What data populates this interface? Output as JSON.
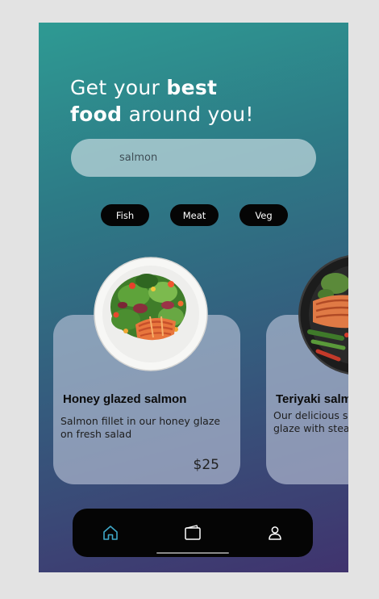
{
  "headline": {
    "line1_normal": "Get your",
    "line1_bold": "best",
    "line2_bold": "food",
    "line2_normal": "around you!"
  },
  "search": {
    "value": "salmon",
    "placeholder": ""
  },
  "filters": [
    "Fish",
    "Meat",
    "Veg"
  ],
  "cards": [
    {
      "title": "Honey glazed salmon",
      "description": "Salmon fillet in our honey glaze on fresh salad",
      "price": "$25",
      "image": "salad-salmon-plate"
    },
    {
      "title": "Teriyaki salmon",
      "description": "Our delicious salmon in teriyaki glaze with steamed vegetables",
      "price": "",
      "image": "teriyaki-salmon-pan"
    }
  ],
  "nav": {
    "items": [
      {
        "icon": "home-icon",
        "active": true
      },
      {
        "icon": "wallet-icon",
        "active": false
      },
      {
        "icon": "user-icon",
        "active": false
      }
    ]
  },
  "colors": {
    "gradient_top": "#2e9a93",
    "gradient_bottom": "#40336e",
    "active_nav": "#3fa8c8",
    "chip_bg": "#050505"
  }
}
